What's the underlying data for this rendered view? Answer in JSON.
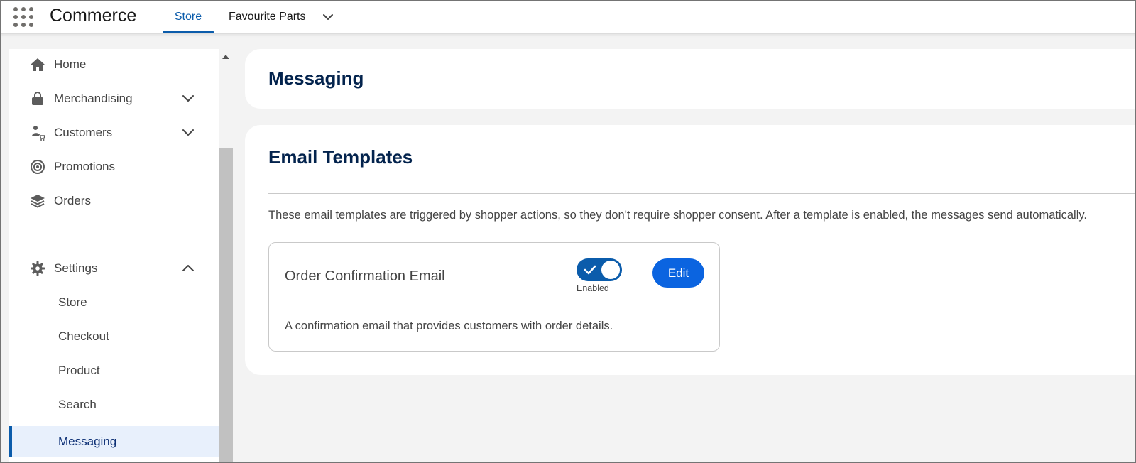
{
  "app": {
    "name": "Commerce",
    "launcher_icon": "app-launcher-grid-icon"
  },
  "top_nav": {
    "tabs": [
      {
        "label": "Store",
        "active": true
      },
      {
        "label": "Favourite Parts",
        "active": false,
        "has_dropdown": true
      }
    ]
  },
  "sidebar": {
    "items": [
      {
        "label": "Home",
        "icon": "home-icon"
      },
      {
        "label": "Merchandising",
        "icon": "lock-bag-icon",
        "expandable": true,
        "expanded": false
      },
      {
        "label": "Customers",
        "icon": "person-cart-icon",
        "expandable": true,
        "expanded": false
      },
      {
        "label": "Promotions",
        "icon": "target-icon"
      },
      {
        "label": "Orders",
        "icon": "layers-icon"
      }
    ],
    "settings": {
      "label": "Settings",
      "icon": "gear-icon",
      "expanded": true,
      "children": [
        {
          "label": "Store"
        },
        {
          "label": "Checkout"
        },
        {
          "label": "Product"
        },
        {
          "label": "Search"
        },
        {
          "label": "Messaging",
          "active": true
        }
      ]
    }
  },
  "main": {
    "page_title": "Messaging",
    "section": {
      "title": "Email Templates",
      "description": "These email templates are triggered by shopper actions, so they don't require shopper consent. After a template is enabled, the messages send automatically.",
      "templates": [
        {
          "name": "Order Confirmation Email",
          "description": "A confirmation email that provides customers with order details.",
          "enabled": true,
          "status_label": "Enabled",
          "edit_label": "Edit"
        }
      ]
    }
  },
  "colors": {
    "brand_blue": "#0b5cab",
    "button_blue": "#0b64e0",
    "title_navy": "#03234d",
    "active_nav_bg": "#e8f0fc"
  }
}
